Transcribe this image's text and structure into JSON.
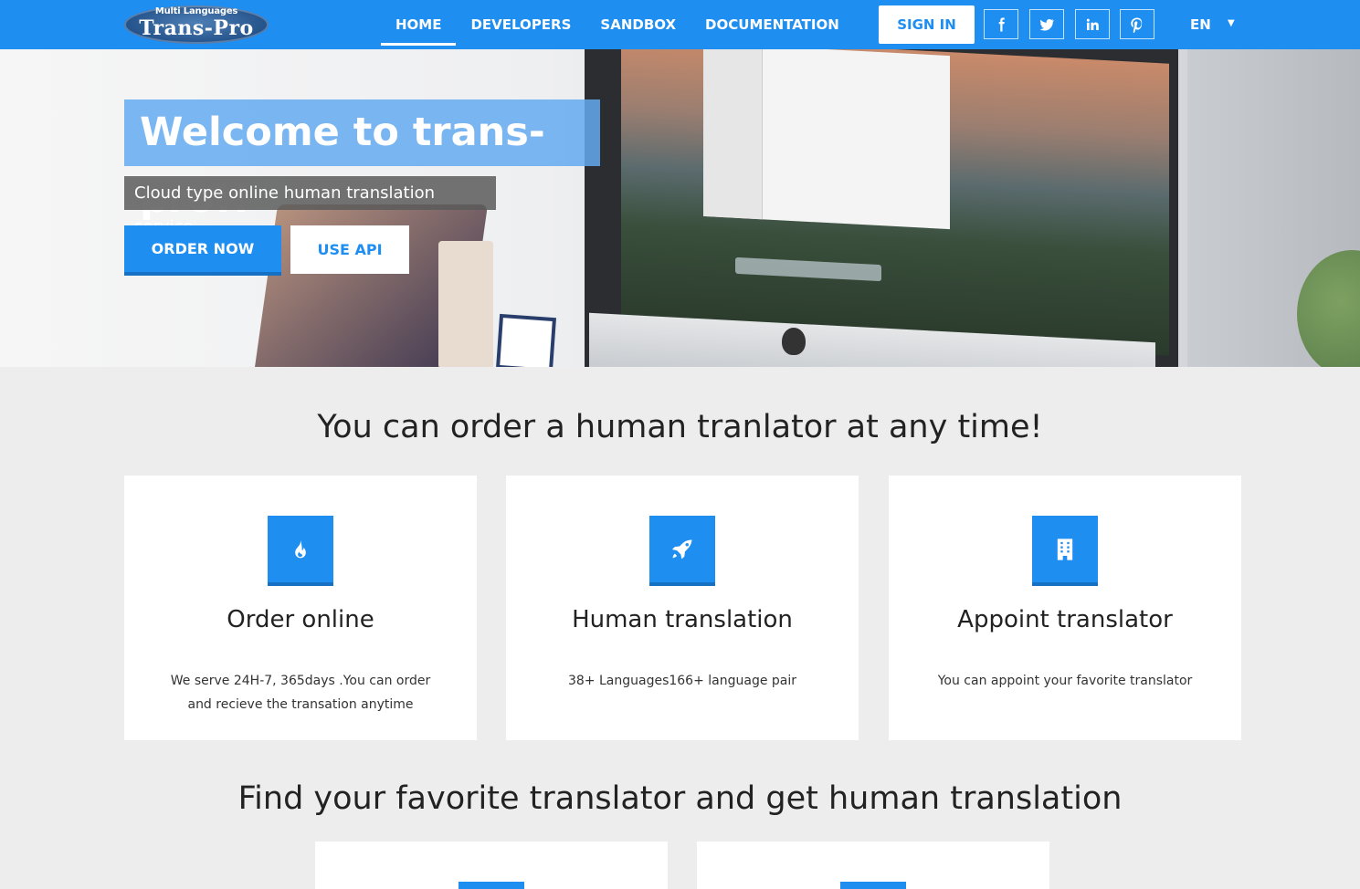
{
  "logo": {
    "small": "Multi Languages",
    "big": "Trans-Pro"
  },
  "nav": {
    "links": [
      "HOME",
      "DEVELOPERS",
      "SANDBOX",
      "DOCUMENTATION"
    ],
    "signin": "SIGN IN",
    "social": [
      "facebook-icon",
      "twitter-icon",
      "linkedin-icon",
      "pinterest-icon"
    ],
    "lang": "EN"
  },
  "hero": {
    "title": "Welcome to trans-pro!!",
    "subtitle": "Cloud type online human translation service",
    "order_button": "ORDER NOW",
    "api_button": "USE API"
  },
  "section1": {
    "title": "You can order a human tranlator at any time!",
    "cards": [
      {
        "icon": "fire-icon",
        "title": "Order online",
        "desc": "We serve 24H-7, 365days .You can order and recieve the transation anytime"
      },
      {
        "icon": "rocket-icon",
        "title": "Human translation",
        "desc": "38+ Languages166+ language pair"
      },
      {
        "icon": "building-icon",
        "title": "Appoint translator",
        "desc": "You can appoint your favorite translator"
      }
    ]
  },
  "section2": {
    "title": "Find your favorite translator and get human translation"
  },
  "colors": {
    "primary": "#1f8ef1",
    "background": "#ededee"
  }
}
